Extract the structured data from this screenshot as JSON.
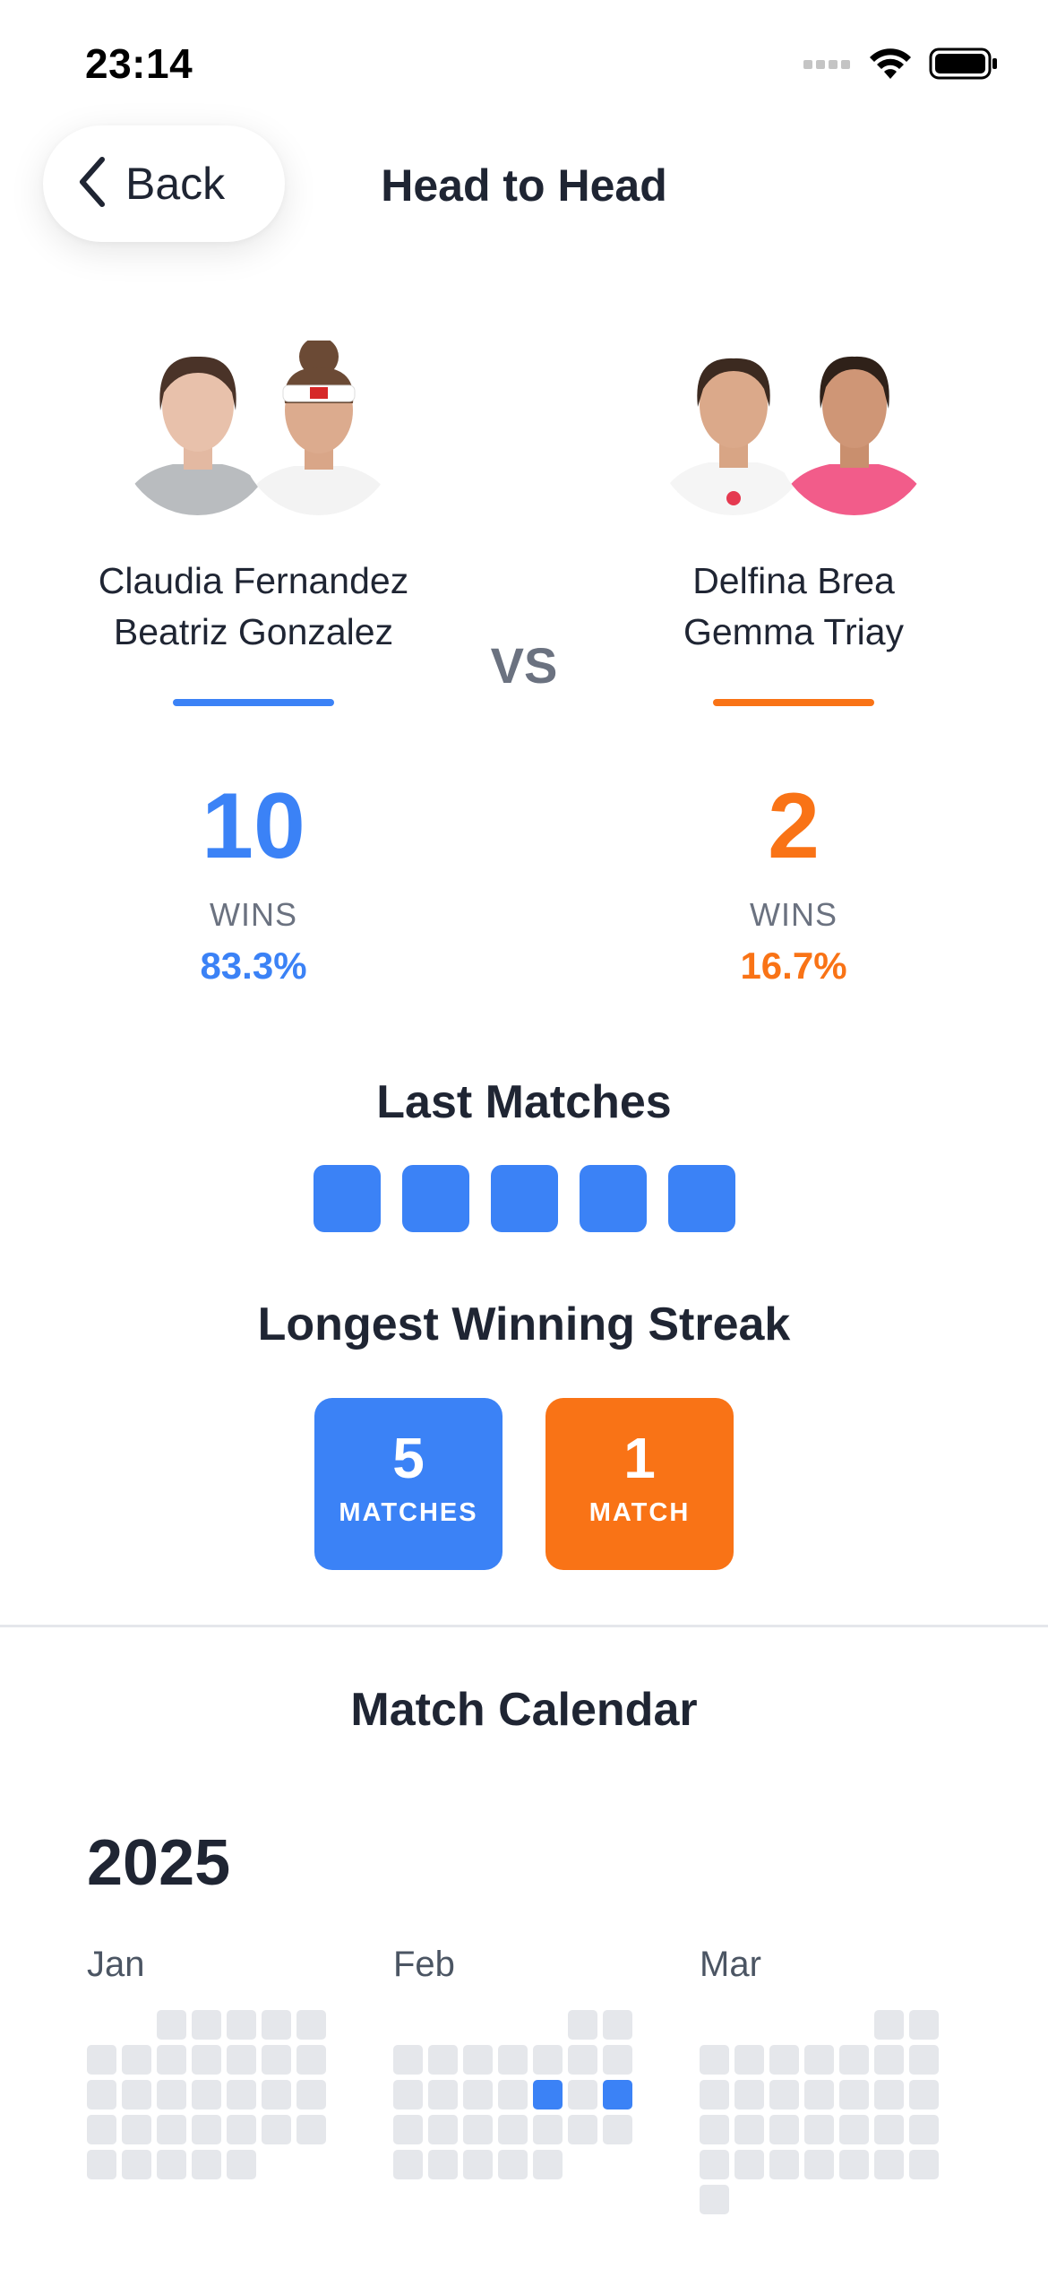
{
  "status_bar": {
    "time": "23:14"
  },
  "nav": {
    "back_label": "Back",
    "title": "Head to Head"
  },
  "teams": [
    {
      "players": [
        "Claudia Fernandez",
        "Beatriz Gonzalez"
      ],
      "color": "#3b82f6",
      "wins": "10",
      "wins_label": "WINS",
      "win_pct": "83.3%"
    },
    {
      "players": [
        "Delfina Brea",
        "Gemma Triay"
      ],
      "color": "#f97316",
      "wins": "2",
      "wins_label": "WINS",
      "win_pct": "16.7%"
    }
  ],
  "vs_label": "VS",
  "last_matches": {
    "title": "Last Matches",
    "results": [
      "team1",
      "team1",
      "team1",
      "team1",
      "team1"
    ]
  },
  "winning_streak": {
    "title": "Longest Winning Streak",
    "team1": {
      "value": "5",
      "unit": "MATCHES"
    },
    "team2": {
      "value": "1",
      "unit": "MATCH"
    }
  },
  "calendar": {
    "title": "Match Calendar",
    "year": "2025",
    "months": [
      {
        "name": "Jan",
        "leading_blanks": 2,
        "days": 31,
        "team1_match_days": [],
        "team2_match_days": []
      },
      {
        "name": "Feb",
        "leading_blanks": 5,
        "days": 28,
        "team1_match_days": [
          14,
          16
        ],
        "team2_match_days": []
      },
      {
        "name": "Mar",
        "leading_blanks": 5,
        "days": 31,
        "team1_match_days": [],
        "team2_match_days": []
      }
    ]
  }
}
